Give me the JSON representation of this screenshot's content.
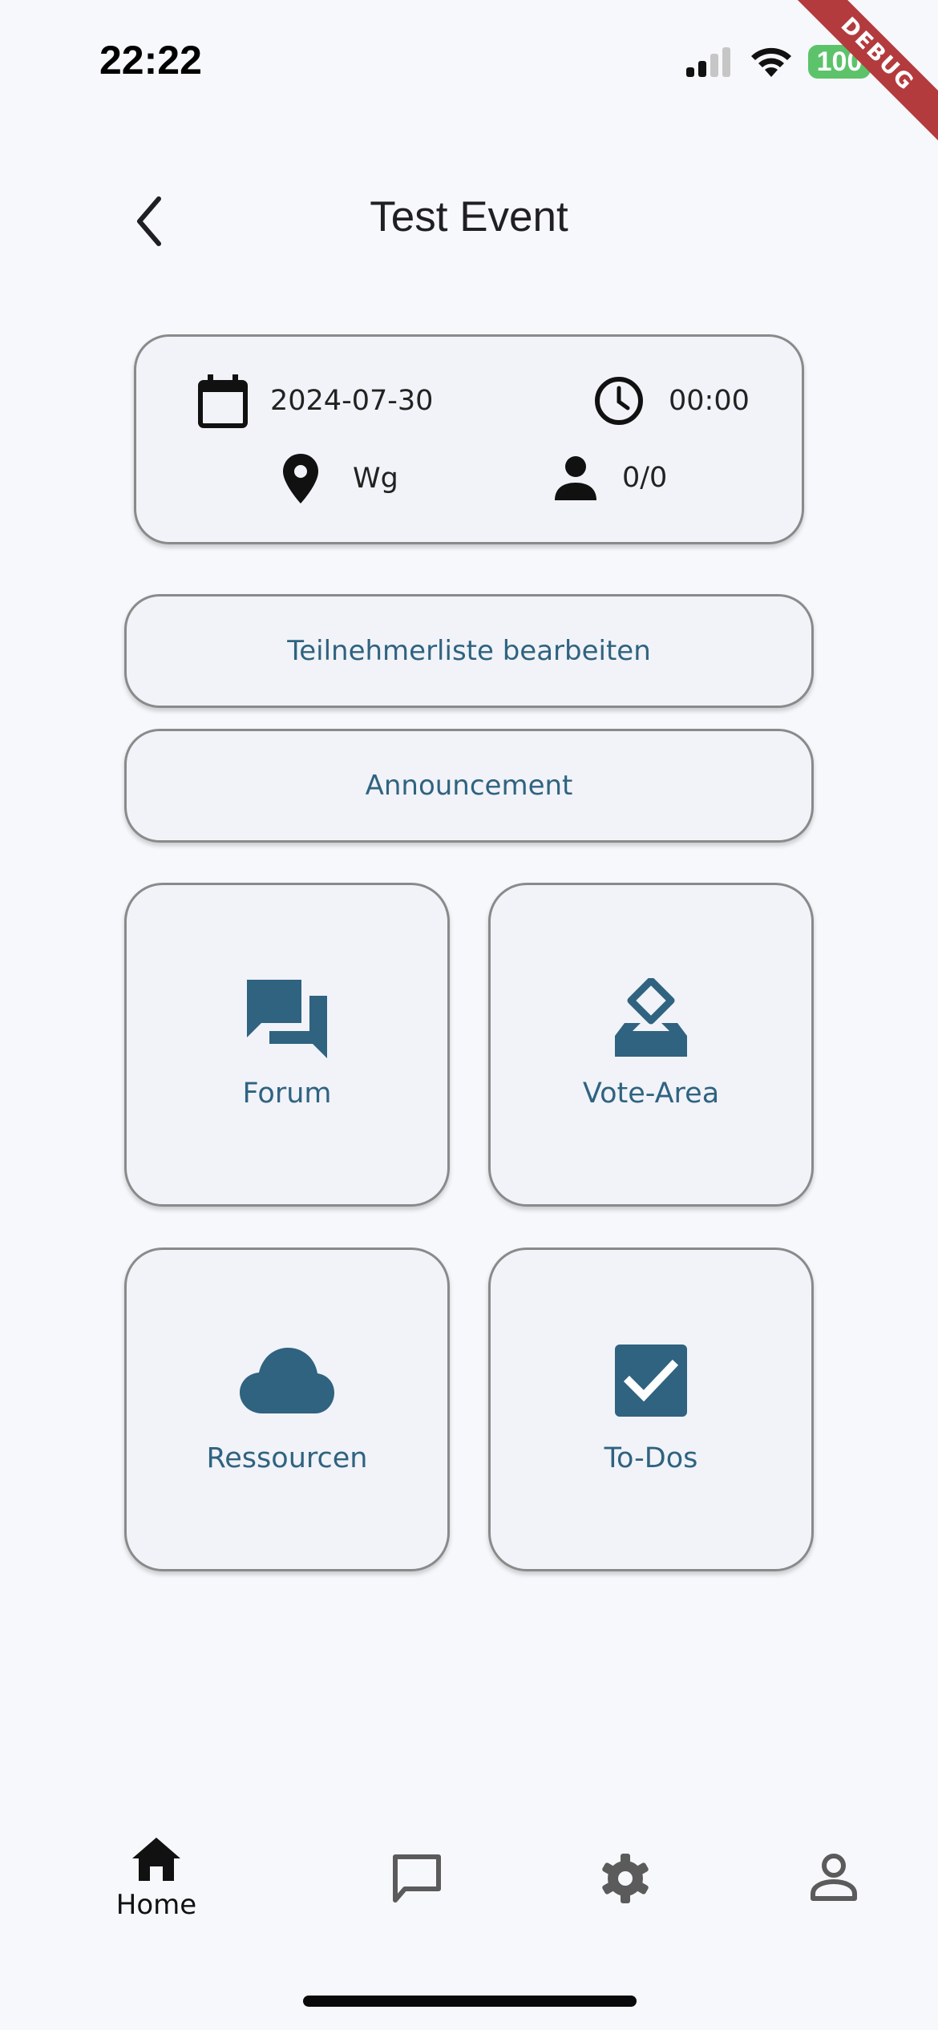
{
  "status_bar": {
    "time": "22:22",
    "battery": "100"
  },
  "debug_banner": "DEBUG",
  "header": {
    "title": "Test Event"
  },
  "info": {
    "date": "2024-07-30",
    "time": "00:00",
    "location": "Wg",
    "participants": "0/0"
  },
  "buttons": {
    "edit_participants": "Teilnehmerliste bearbeiten",
    "announcement": "Announcement"
  },
  "tiles": [
    {
      "label": "Forum",
      "icon": "forum-icon"
    },
    {
      "label": "Vote-Area",
      "icon": "ballot-icon"
    },
    {
      "label": "Ressourcen",
      "icon": "cloud-icon"
    },
    {
      "label": "To-Dos",
      "icon": "checkbox-icon"
    }
  ],
  "bottom_nav": [
    {
      "label": "Home",
      "icon": "home-icon",
      "active": true
    },
    {
      "label": "",
      "icon": "chat-icon"
    },
    {
      "label": "",
      "icon": "gear-icon"
    },
    {
      "label": "",
      "icon": "person-icon"
    }
  ],
  "colors": {
    "accent": "#2f6380",
    "background": "#f6f8fc",
    "card": "#f1f3f8",
    "border": "#8a8a8a"
  }
}
